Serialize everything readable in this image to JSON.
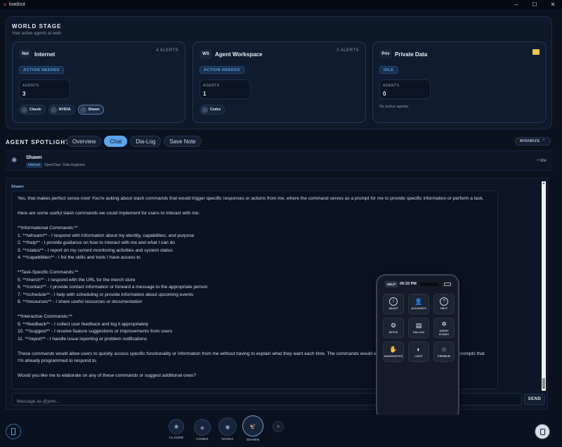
{
  "window": {
    "title": "loadout",
    "controls": [
      "–",
      "☐",
      "✕"
    ]
  },
  "world_stage": {
    "title": "WORLD STAGE",
    "subtitle": "Your active agents at work",
    "zones": [
      {
        "code": "Net",
        "name": "Internet",
        "alerts": "4 ALERTS",
        "status": "ACTION NEEDED",
        "agents_label": "AGENTS",
        "agents_count": "3",
        "chips": [
          "Claude",
          "NVIDIA",
          "Shawn"
        ]
      },
      {
        "code": "WS",
        "name": "Agent Workspace",
        "alerts": "2 ALERTS",
        "status": "ACTION NEEDED",
        "agents_label": "AGENTS",
        "agents_count": "1",
        "chips": [
          "Codex"
        ]
      },
      {
        "code": "Priv",
        "name": "Private Data",
        "icon": "folder-icon",
        "status": "IDLE",
        "agents_label": "AGENTS",
        "agents_count": "0",
        "empty_text": "No active agents."
      }
    ]
  },
  "spotlight": {
    "title": "AGENT SPOTLIGHT",
    "tabs": [
      "Overview",
      "Chat",
      "Dia-Log",
      "Save Note"
    ],
    "active_tab": "Chat",
    "minimize_label": "MINIMIZE",
    "agent": {
      "name": "Shawn",
      "zone": "Internet",
      "platform": "OpenClaw",
      "role": "Data Engineer",
      "state": "Idle"
    }
  },
  "chat": {
    "sender": "Shawn",
    "message": "Yes, that makes perfect sense now! You're asking about slash commands that would trigger specific responses or actions from me, where the command serves as a prompt for me to provide specific information or perform a task.\n\nHere are some useful slash commands we could implement for users to interact with me:\n\n**Informational Commands:**\n1. **/whoami** - I respond with information about my identity, capabilities, and purpose\n2. **/help** - I provide guidance on how to interact with me and what I can do\n3. **/status** - I report on my current monitoring activities and system status\n4. **/capabilities** - I list the skills and tools I have access to\n\n**Task-Specific Commands:**\n5. **/merch** - I respond with the URL for the merch store\n6. **/contact** - I provide contact information or forward a message to the appropriate person\n7. **/schedule** - I help with scheduling or provide information about upcoming events\n8. **/resources** - I share useful resources or documentation\n\n**Interactive Commands:**\n9. **/feedback** - I collect user feedback and log it appropriately\n10. **/suggest** - I receive feature suggestions or improvements from users\n11. **/report** - I handle issue reporting or problem notifications\n\nThese commands would allow users to quickly access specific functionality or information from me without having to explain what they want each time. The commands would essentially serve as shortcuts for specific prompts that I'm already programmed to respond to.\n\nWould you like me to elaborate on any of these commands or suggest additional ones?",
    "input_placeholder": "Message as @john...",
    "send_label": "SEND"
  },
  "phone": {
    "help_tag": "HELP",
    "time": "09:33 PM",
    "apps": [
      {
        "label": "ABOUT",
        "glyph": "i"
      },
      {
        "label": "ACCOUNTS",
        "glyph": "👤"
      },
      {
        "label": "HELP",
        "glyph": "?"
      },
      {
        "label": "SETUP",
        "glyph": "⚙"
      },
      {
        "label": "DIA-LOG",
        "glyph": "▤"
      },
      {
        "label": "AGENT STUDIO",
        "glyph": "✲"
      },
      {
        "label": "DIAGNOSTICS",
        "glyph": "✋"
      },
      {
        "label": "LIGHT",
        "glyph": "◐"
      },
      {
        "label": "PREMIUM",
        "glyph": "☆"
      }
    ]
  },
  "dock": {
    "agents": [
      {
        "name": "CLAUDE",
        "glyph": "✺"
      },
      {
        "name": "CODEX",
        "glyph": "◈"
      },
      {
        "name": "NVIDIA",
        "glyph": "◉"
      },
      {
        "name": "SHAWN",
        "glyph": "🦅"
      }
    ],
    "add_label": "+"
  }
}
